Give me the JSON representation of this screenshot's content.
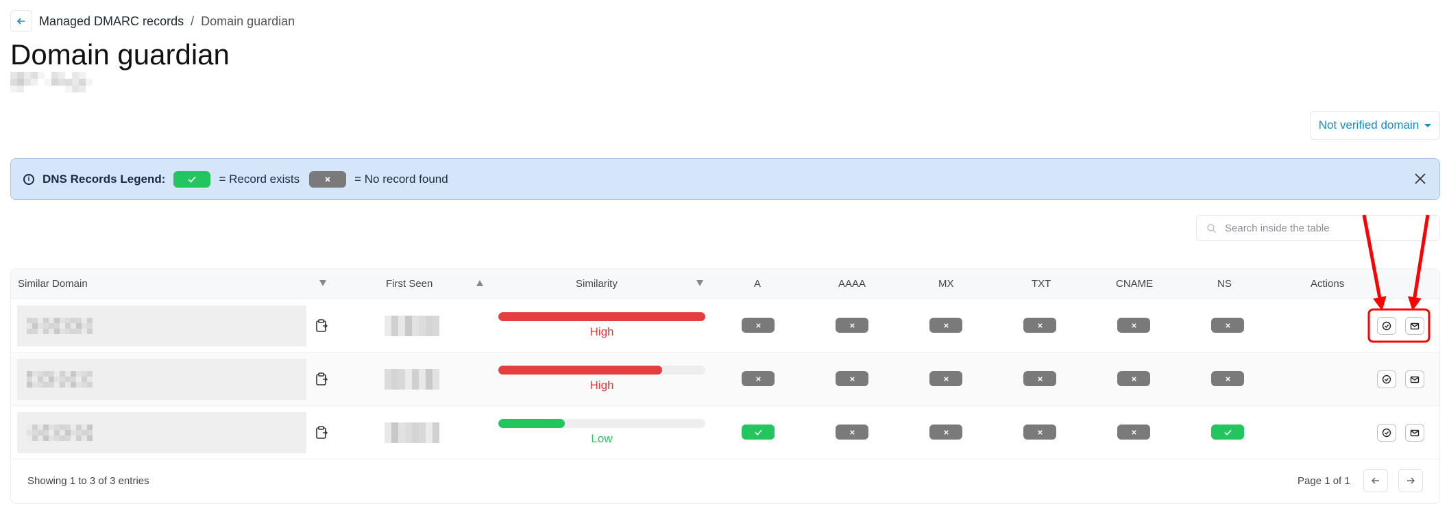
{
  "breadcrumb": {
    "parent": "Managed DMARC records",
    "separator": "/",
    "current": "Domain guardian"
  },
  "page": {
    "title": "Domain guardian"
  },
  "verify_dropdown": {
    "label": "Not verified domain"
  },
  "legend": {
    "title": "DNS Records Legend:",
    "exists_text": "= Record exists",
    "missing_text": "= No record found"
  },
  "search": {
    "placeholder": "Search inside the table",
    "value": ""
  },
  "table": {
    "columns": {
      "similar_domain": "Similar Domain",
      "first_seen": "First Seen",
      "similarity": "Similarity",
      "a": "A",
      "aaaa": "AAAA",
      "mx": "MX",
      "txt": "TXT",
      "cname": "CNAME",
      "ns": "NS",
      "actions": "Actions"
    },
    "sort": {
      "similar_domain": "descending",
      "first_seen": "ascending",
      "similarity": "descending"
    },
    "rows": [
      {
        "similarity_label": "High",
        "similarity_level": 1.0,
        "similarity_color": "#e53e3e",
        "records": {
          "a": false,
          "aaaa": false,
          "mx": false,
          "txt": false,
          "cname": false,
          "ns": false
        }
      },
      {
        "similarity_label": "High",
        "similarity_level": 0.79,
        "similarity_color": "#e53e3e",
        "records": {
          "a": false,
          "aaaa": false,
          "mx": false,
          "txt": false,
          "cname": false,
          "ns": false
        }
      },
      {
        "similarity_label": "Low",
        "similarity_level": 0.32,
        "similarity_color": "#22c55e",
        "records": {
          "a": true,
          "aaaa": false,
          "mx": false,
          "txt": false,
          "cname": false,
          "ns": true
        }
      }
    ]
  },
  "footer": {
    "entries_text": "Showing 1 to 3 of 3 entries",
    "page_text": "Page 1 of 1"
  },
  "colors": {
    "accent": "#0e8fd0",
    "record_exists": "#22c55e",
    "record_missing": "#7a7a7a",
    "high": "#e53e3e",
    "low": "#22c55e",
    "annotation": "#ff0000"
  },
  "icons": {
    "back": "arrow-left-icon",
    "info": "info-icon",
    "close": "close-icon",
    "search": "search-icon",
    "copy": "clipboard-copy-icon",
    "check": "check-icon",
    "cross": "x-icon",
    "action_1": "badge-check-icon",
    "action_2": "mail-icon",
    "prev": "arrow-left-icon",
    "next": "arrow-right-icon"
  }
}
